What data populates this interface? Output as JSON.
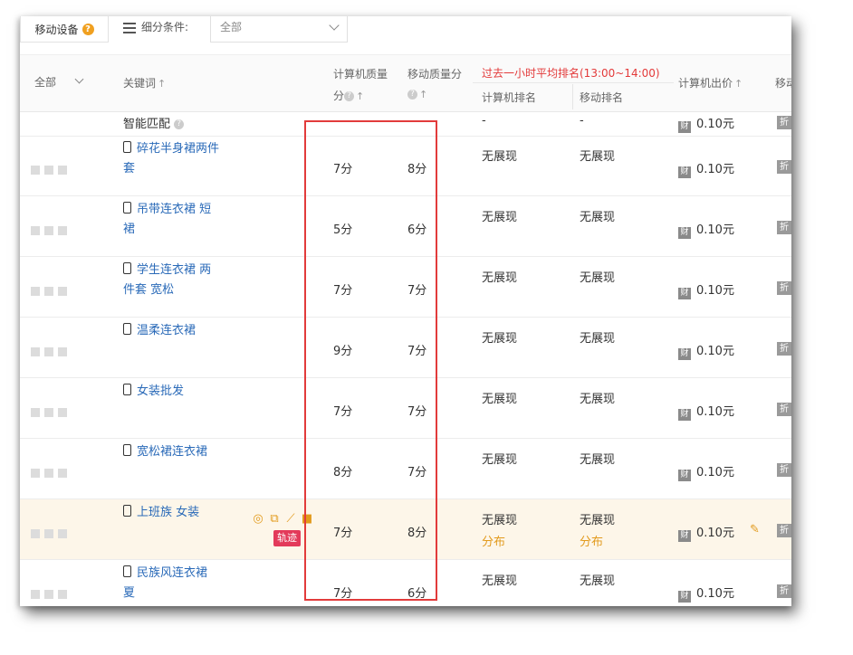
{
  "topbar": {
    "device_label": "移动设备",
    "filter_label": "细分条件:",
    "filter_value": "全部"
  },
  "header": {
    "all_label": "全部",
    "keyword": "关键词",
    "pc_quality_line1": "计算机质量",
    "pc_quality_line2": "分",
    "mobile_quality": "移动质量分",
    "past_hour": "过去一小时平均排名(13:00~14:00)",
    "pc_rank": "计算机排名",
    "mobile_rank": "移动排名",
    "pc_bid": "计算机出价",
    "mobile_bid_partial": "移动"
  },
  "smart_row": {
    "label": "智能匹配",
    "pc_rank": "-",
    "mobile_rank": "-",
    "bid": "0.10元"
  },
  "rows": [
    {
      "kw1": "碎花半身裙两件",
      "kw2": "套",
      "pc_q": "7分",
      "mob_q": "8分",
      "pc_rank": "无展现",
      "mob_rank": "无展现",
      "bid": "0.10元"
    },
    {
      "kw1": "吊带连衣裙 短",
      "kw2": "裙",
      "pc_q": "5分",
      "mob_q": "6分",
      "pc_rank": "无展现",
      "mob_rank": "无展现",
      "bid": "0.10元"
    },
    {
      "kw1": "学生连衣裙 两",
      "kw2": "件套 宽松",
      "pc_q": "7分",
      "mob_q": "7分",
      "pc_rank": "无展现",
      "mob_rank": "无展现",
      "bid": "0.10元"
    },
    {
      "kw1": "温柔连衣裙",
      "kw2": "",
      "pc_q": "9分",
      "mob_q": "7分",
      "pc_rank": "无展现",
      "mob_rank": "无展现",
      "bid": "0.10元"
    },
    {
      "kw1": "女装批发",
      "kw2": "",
      "pc_q": "7分",
      "mob_q": "7分",
      "pc_rank": "无展现",
      "mob_rank": "无展现",
      "bid": "0.10元"
    },
    {
      "kw1": "宽松裙连衣裙",
      "kw2": "",
      "pc_q": "8分",
      "mob_q": "7分",
      "pc_rank": "无展现",
      "mob_rank": "无展现",
      "bid": "0.10元"
    },
    {
      "kw1": "上班族 女装",
      "kw2": "",
      "pc_q": "7分",
      "mob_q": "8分",
      "pc_rank": "无展现",
      "mob_rank": "无展现",
      "bid": "0.10元",
      "highlight": true,
      "dist": "分布",
      "track": "轨迹"
    },
    {
      "kw1": "民族风连衣裙",
      "kw2": "夏",
      "pc_q": "7分",
      "mob_q": "6分",
      "pc_rank": "无展现",
      "mob_rank": "无展现",
      "bid": "0.10元"
    }
  ],
  "icons": {
    "bid": "财",
    "cut": "折"
  }
}
